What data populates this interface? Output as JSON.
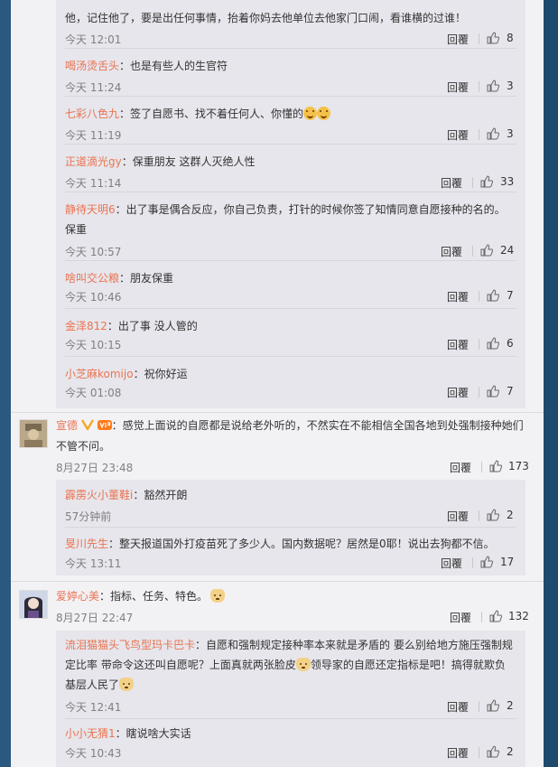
{
  "threads": [
    {
      "replies": [
        {
          "partial": true,
          "name": "",
          "text_line1": "他，记住他了，要是出任何事情，抬着你妈去他单位去他家门口闹，看谁横的过谁！",
          "time": "今天 12:01",
          "reply_label": "回覆",
          "likes": "8"
        },
        {
          "name": "喝汤烫舌头",
          "text": "：也是有些人的生官符",
          "time": "今天 11:24",
          "reply_label": "回覆",
          "likes": "3"
        },
        {
          "name": "七彩八色九",
          "text": "：签了自愿书、找不着任何人、你懂的",
          "time": "今天 11:19",
          "reply_label": "回覆",
          "likes": "3"
        },
        {
          "name": "正道滴光gy",
          "text": "：保重朋友  这群人灭绝人性",
          "time": "今天 11:14",
          "reply_label": "回覆",
          "likes": "33"
        },
        {
          "name": "静待天明6",
          "text": "：出了事是偶合反应，你自己负责，打针的时候你签了知情同意自愿接种的名的。",
          "text_line2": "保重",
          "time": "今天 10:57",
          "reply_label": "回覆",
          "likes": "24"
        },
        {
          "name": "啥叫交公粮",
          "text": "：朋友保重",
          "time": "今天 10:46",
          "reply_label": "回覆",
          "likes": "7"
        },
        {
          "name": "金泽812",
          "text": "：出了事 没人管的",
          "time": "今天 10:15",
          "reply_label": "回覆",
          "likes": "6"
        },
        {
          "name": "小芝麻komijo",
          "text": "：祝你好运",
          "time": "今天 01:08",
          "reply_label": "回覆",
          "likes": "7"
        }
      ]
    },
    {
      "name": "宣德",
      "text_line1": "：感觉上面说的自愿都是说给老外听的，不然实在不能相信全国各地到处强制接种她们",
      "text_line2": "不管不问。",
      "time": "8月27日 23:48",
      "reply_label": "回覆",
      "likes": "173",
      "replies": [
        {
          "name": "霹雳火小董鞋i",
          "text": "：豁然开朗",
          "time": "57分钟前",
          "reply_label": "回覆",
          "likes": "2"
        },
        {
          "name": "旻川先生",
          "text": "：整天报道国外打疫苗死了多少人。国内数据呢？居然是0耶！说出去狗都不信。",
          "time": "今天 13:11",
          "reply_label": "回覆",
          "likes": "17"
        }
      ]
    },
    {
      "name": "爱婷心美",
      "text": "：指标、任务、特色。",
      "time": "8月27日 22:47",
      "reply_label": "回覆",
      "likes": "132",
      "replies": [
        {
          "name": "流泪猫猫头飞鸟型玛卡巴卡",
          "text_line1": "：自愿和强制规定接种率本来就是矛盾的 要么别给地方施压强制规",
          "text_line2": "定比率 带命令这还叫自愿呢？上面真就两张脸皮",
          "text_line2b": "领导家的自愿还定指标是吧！搞得就欺负",
          "text_line3": "基层人民了",
          "time": "今天 12:41",
          "reply_label": "回覆",
          "likes": "2"
        },
        {
          "name": "小小无猜1",
          "text": "：瞎说啥大实话",
          "time": "今天 10:43",
          "reply_label": "回覆",
          "likes": "2"
        }
      ]
    }
  ],
  "icons": {
    "like": "thumb-up-icon",
    "verified": "v-badge-icon",
    "vip": "vip-badge-icon",
    "emoji_grin": "grin-emoji-icon",
    "emoji_dog": "dog-emoji-icon"
  },
  "colors": {
    "username": "#eb7350",
    "time": "#808080",
    "panel_bg": "#f2f2f5",
    "reply_bg": "#e6e6ec",
    "page_bg": "#234e72"
  }
}
